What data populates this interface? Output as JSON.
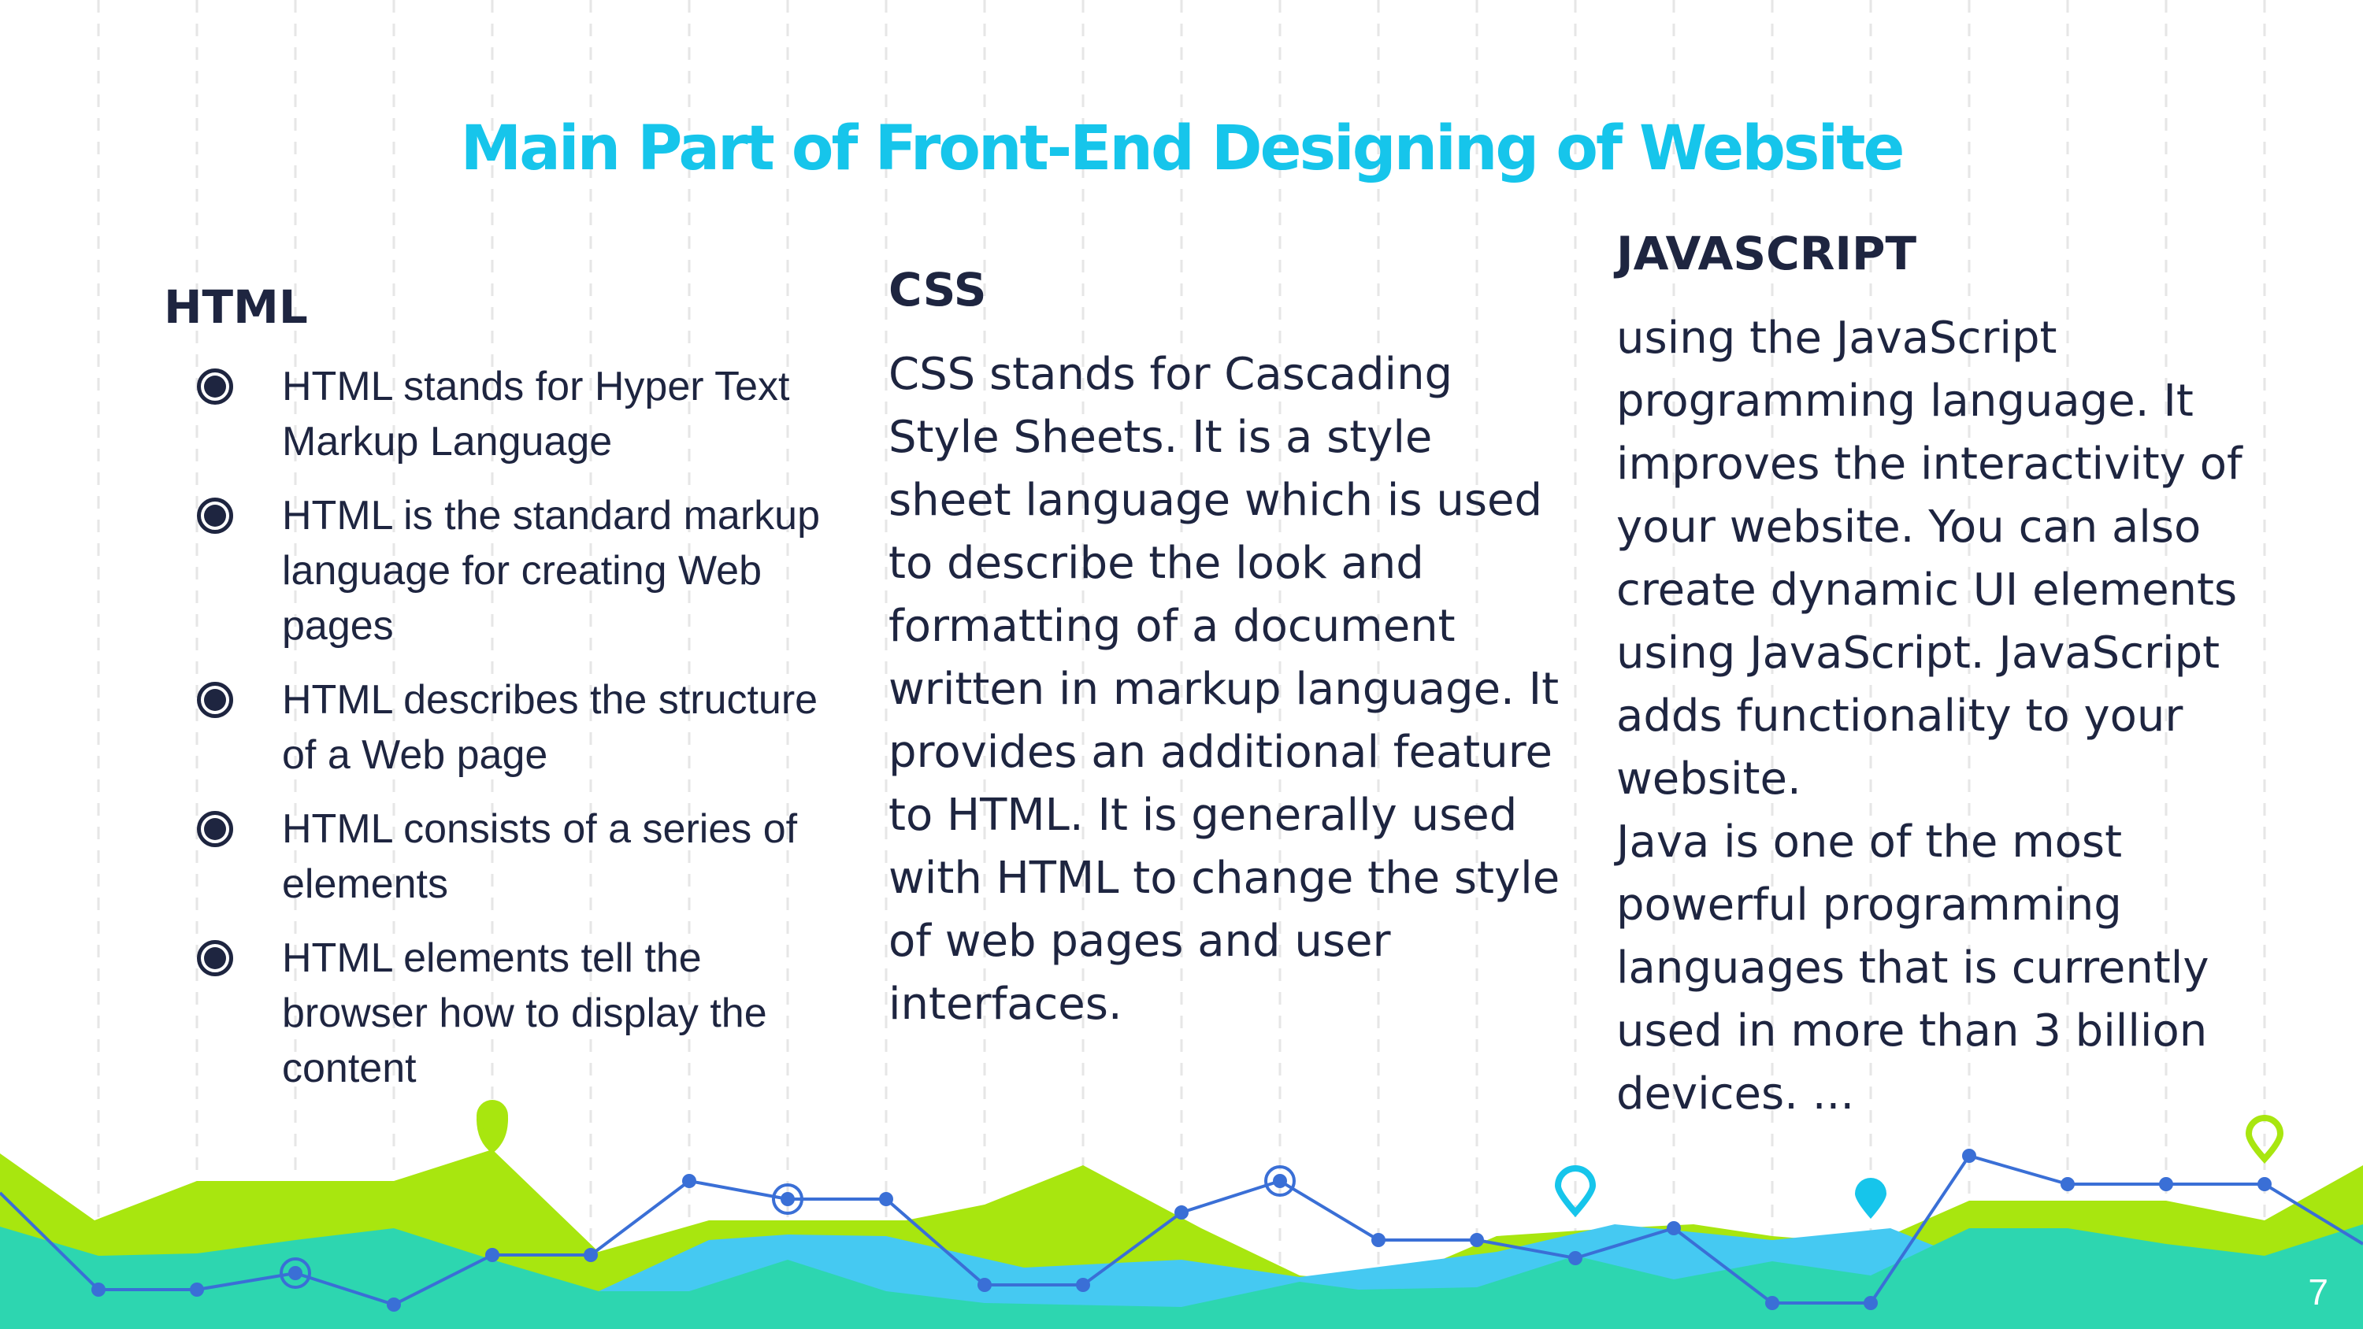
{
  "slide": {
    "title": "Main Part of Front-End Designing of Website",
    "page_number": "7"
  },
  "html_section": {
    "heading": "HTML",
    "bullets": [
      "HTML stands for Hyper Text Markup Language",
      "HTML is the standard markup language for creating Web pages",
      "HTML describes the structure of a Web page",
      "HTML consists of a series of elements",
      "HTML elements tell the browser how to display the content"
    ]
  },
  "css_section": {
    "heading": "CSS",
    "body": "CSS stands for Cascading Style Sheets. It is a style sheet language which is used to describe the look and formatting of a document written in markup language. It provides an additional feature to HTML. It is generally used with HTML to change the style of web pages and user interfaces."
  },
  "js_section": {
    "heading": "JAVASCRIPT",
    "body_1": "using the JavaScript programming language. It improves the interactivity of your website. You can also create dynamic UI elements using JavaScript. JavaScript adds functionality to your website.",
    "body_2": "Java is one of the most powerful programming languages that is currently used in more than 3 billion devices. ..."
  },
  "colors": {
    "title": "#16c5eb",
    "text": "#1e2540",
    "lime": "#a8e60f",
    "teal": "#2dd6b0",
    "sky": "#45c9f2",
    "line": "#3a6fd6"
  }
}
